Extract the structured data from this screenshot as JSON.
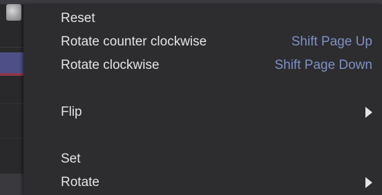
{
  "menu": {
    "items": [
      {
        "label": "Reset",
        "shortcut": ""
      },
      {
        "label": "Rotate counter clockwise",
        "shortcut": "Shift Page Up"
      },
      {
        "label": "Rotate clockwise",
        "shortcut": "Shift Page Down"
      },
      {
        "label": "Flip",
        "shortcut": "",
        "submenu": true
      },
      {
        "label": "Set",
        "shortcut": ""
      },
      {
        "label": "Rotate",
        "shortcut": "",
        "submenu": true
      }
    ]
  },
  "colors": {
    "menu_background": "#2d2d30",
    "label_text": "#e4e4e6",
    "shortcut_text": "#7f90c4",
    "selection_accent": "#4d4f86"
  }
}
